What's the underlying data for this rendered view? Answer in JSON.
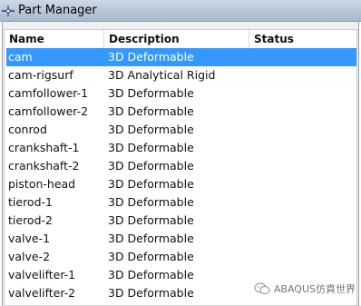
{
  "window": {
    "title": "Part Manager"
  },
  "table": {
    "columns": [
      "Name",
      "Description",
      "Status"
    ],
    "selected_index": 0,
    "rows": [
      {
        "name": "cam",
        "description": "3D Deformable",
        "status": ""
      },
      {
        "name": "cam-rigsurf",
        "description": "3D Analytical Rigid",
        "status": ""
      },
      {
        "name": "camfollower-1",
        "description": "3D Deformable",
        "status": ""
      },
      {
        "name": "camfollower-2",
        "description": "3D Deformable",
        "status": ""
      },
      {
        "name": "conrod",
        "description": "3D Deformable",
        "status": ""
      },
      {
        "name": "crankshaft-1",
        "description": "3D Deformable",
        "status": ""
      },
      {
        "name": "crankshaft-2",
        "description": "3D Deformable",
        "status": ""
      },
      {
        "name": "piston-head",
        "description": "3D Deformable",
        "status": ""
      },
      {
        "name": "tierod-1",
        "description": "3D Deformable",
        "status": ""
      },
      {
        "name": "tierod-2",
        "description": "3D Deformable",
        "status": ""
      },
      {
        "name": "valve-1",
        "description": "3D Deformable",
        "status": ""
      },
      {
        "name": "valve-2",
        "description": "3D Deformable",
        "status": ""
      },
      {
        "name": "valvelifter-1",
        "description": "3D Deformable",
        "status": ""
      },
      {
        "name": "valvelifter-2",
        "description": "3D Deformable",
        "status": ""
      }
    ]
  },
  "watermark": {
    "text": "ABAQUS仿真世界"
  },
  "colors": {
    "selection": "#3399ff"
  }
}
